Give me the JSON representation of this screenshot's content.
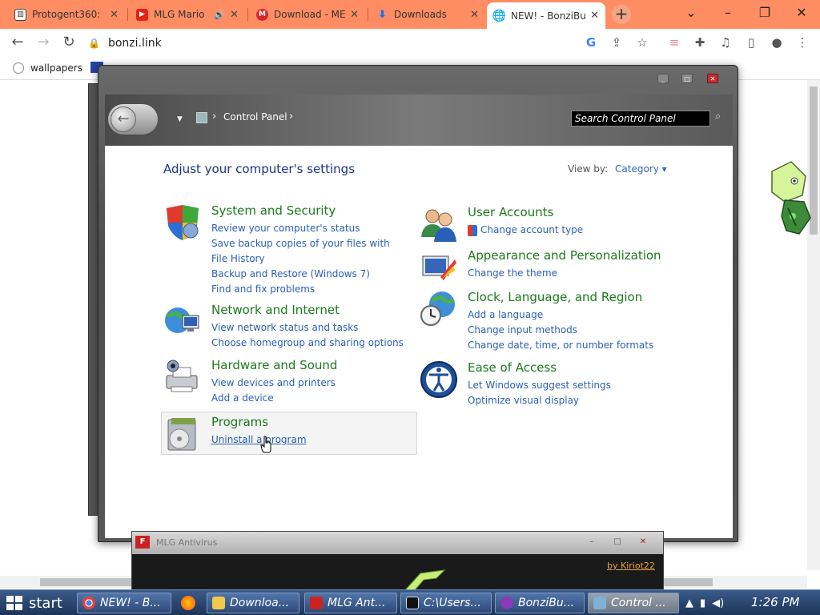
{
  "browser": {
    "tabs": [
      {
        "title": "Protogent360:",
        "favicon_icon": "museum-icon"
      },
      {
        "title": "MLG Mario",
        "favicon_icon": "youtube-icon"
      },
      {
        "title": "Download - ME",
        "favicon_icon": "mega-icon"
      },
      {
        "title": "Downloads",
        "favicon_icon": "download-icon"
      },
      {
        "title": "NEW! - BonziBu",
        "favicon_icon": "globe-icon"
      }
    ],
    "new_tab_label": "+",
    "url": "bonzi.link",
    "bookmarks": [
      {
        "label": "wallpapers"
      }
    ],
    "window_controls": {
      "minimize": "–",
      "restore": "❐",
      "close": "✕"
    }
  },
  "control_panel": {
    "breadcrumb": "Control Panel",
    "search_placeholder": "Search Control Panel",
    "heading": "Adjust your computer's settings",
    "view_by_label": "View by:",
    "view_by_value": "Category ▾",
    "categories": [
      {
        "title": "System and Security",
        "links": [
          "Review your computer's status",
          "Save backup copies of your files with File History",
          "Backup and Restore (Windows 7)",
          "Find and fix problems"
        ]
      },
      {
        "title": "Network and Internet",
        "links": [
          "View network status and tasks",
          "Choose homegroup and sharing options"
        ]
      },
      {
        "title": "Hardware and Sound",
        "links": [
          "View devices and printers",
          "Add a device"
        ]
      },
      {
        "title": "Programs",
        "links": [
          "Uninstall a program"
        ]
      },
      {
        "title": "User Accounts",
        "links": [
          "Change account type"
        ]
      },
      {
        "title": "Appearance and Personalization",
        "links": [
          "Change the theme"
        ]
      },
      {
        "title": "Clock, Language, and Region",
        "links": [
          "Add a language",
          "Change input methods",
          "Change date, time, or number formats"
        ]
      },
      {
        "title": "Ease of Access",
        "links": [
          "Let Windows suggest settings",
          "Optimize visual display"
        ]
      }
    ]
  },
  "antivirus": {
    "title": "MLG Antivirus",
    "credit": "by Kiriot22"
  },
  "taskbar": {
    "start_label": "start",
    "items": [
      "NEW! - B...",
      "Downloa...",
      "MLG Ant...",
      "C:\\Users...",
      "BonziBu...",
      "Control ..."
    ],
    "clock": "1:26 PM"
  },
  "colors": {
    "tab_bar": "#fe8d63",
    "category_title": "#1b7a1b",
    "link": "#2a5fb8",
    "heading": "#1e3287",
    "taskbar": "#2d4a78"
  }
}
